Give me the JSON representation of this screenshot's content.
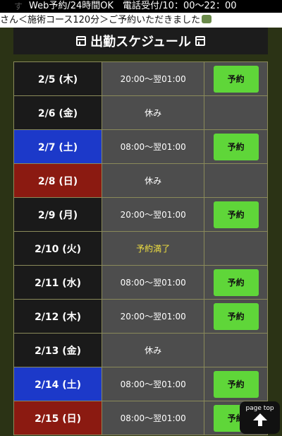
{
  "topbar": {
    "ghost": "す",
    "text": "Web予約/24時間OK　電話受付/10：00〜22：00"
  },
  "marquee": {
    "text": "さん＜施術コース120分＞ご予約いただきました"
  },
  "header": {
    "title": "出勤スケジュール"
  },
  "reserve_label": "予約",
  "rows": [
    {
      "date": "2/5 (木)",
      "time": "20:00〜翌01:00",
      "day": "weekday",
      "reserve": true
    },
    {
      "date": "2/6 (金)",
      "time": "休み",
      "day": "weekday",
      "reserve": false
    },
    {
      "date": "2/7 (土)",
      "time": "08:00〜翌01:00",
      "day": "sat",
      "reserve": true
    },
    {
      "date": "2/8 (日)",
      "time": "休み",
      "day": "sun",
      "reserve": false
    },
    {
      "date": "2/9 (月)",
      "time": "20:00〜翌01:00",
      "day": "weekday",
      "reserve": true
    },
    {
      "date": "2/10 (火)",
      "time": "予約満了",
      "day": "weekday",
      "reserve": false,
      "full": true
    },
    {
      "date": "2/11 (水)",
      "time": "08:00〜翌01:00",
      "day": "weekday",
      "reserve": true
    },
    {
      "date": "2/12 (木)",
      "time": "20:00〜翌01:00",
      "day": "weekday",
      "reserve": true
    },
    {
      "date": "2/13 (金)",
      "time": "休み",
      "day": "weekday",
      "reserve": false
    },
    {
      "date": "2/14 (土)",
      "time": "08:00〜翌01:00",
      "day": "sat",
      "reserve": true
    },
    {
      "date": "2/15 (日)",
      "time": "08:00〜翌01:00",
      "day": "sun",
      "reserve": true
    }
  ],
  "pagetop": {
    "label": "page top"
  },
  "colors": {
    "weekday": "#1a1a1a",
    "sat": "#1c39c9",
    "sun": "#8b1a11",
    "button": "#5fd639",
    "full": "#f0e040"
  }
}
